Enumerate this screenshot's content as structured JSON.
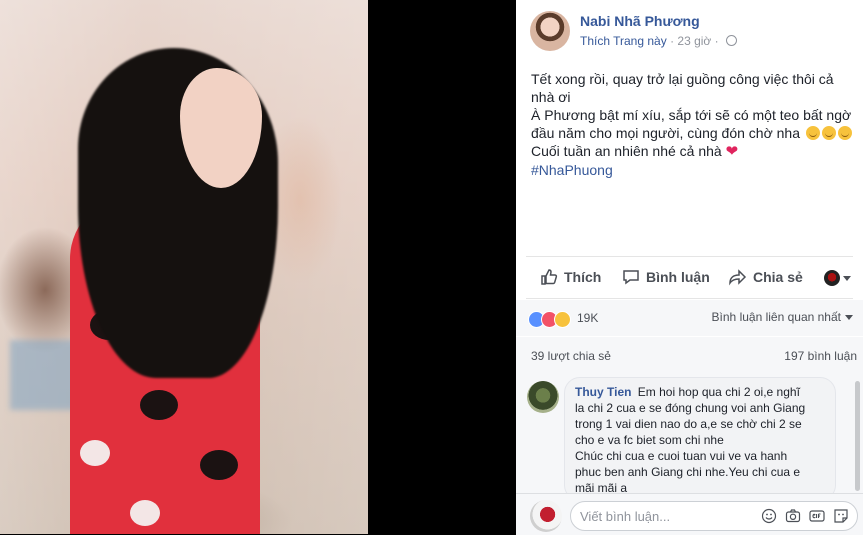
{
  "post": {
    "author": "Nabi Nhã Phương",
    "page_action": "Thích Trang này",
    "separator": "·",
    "time": "23 giờ",
    "lines": [
      "Tết xong rồi, quay trở lại guồng công việc thôi cả",
      "nhà ơi",
      "À Phương bật mí xíu, sắp tới sẽ có một teo bất ngờ",
      "đầu năm cho mọi người, cùng đón chờ nha",
      "Cuối tuần an nhiên nhé cả nhà",
      "#NhaPhuong"
    ]
  },
  "actions": {
    "like": "Thích",
    "comment": "Bình luận",
    "share": "Chia sẻ"
  },
  "reactions": {
    "count": "19K",
    "sort_label": "Bình luận liên quan nhất"
  },
  "stats": {
    "shares": "39 lượt chia sẻ",
    "comments": "197 bình luận"
  },
  "comment": {
    "name": "Thuy Tien",
    "lines": [
      "Em hoi hop qua chi 2 oi,e nghĩ",
      "la chi 2 cua e se đóng chung voi anh Giang",
      "trong 1 vai dien nao do a,e se chờ chi 2 se",
      "cho e va fc biet som chi nhe",
      "Chúc chi cua e cuoi tuan vui ve va hanh",
      "phuc ben anh Giang chi nhe.Yeu chi cua e",
      "mãi mãi a"
    ]
  },
  "composer": {
    "placeholder": "Viết bình luận..."
  },
  "colors": {
    "link": "#365899",
    "like_blue": "#5890ff",
    "love_red": "#f25268",
    "haha_yellow": "#f7c23c"
  }
}
